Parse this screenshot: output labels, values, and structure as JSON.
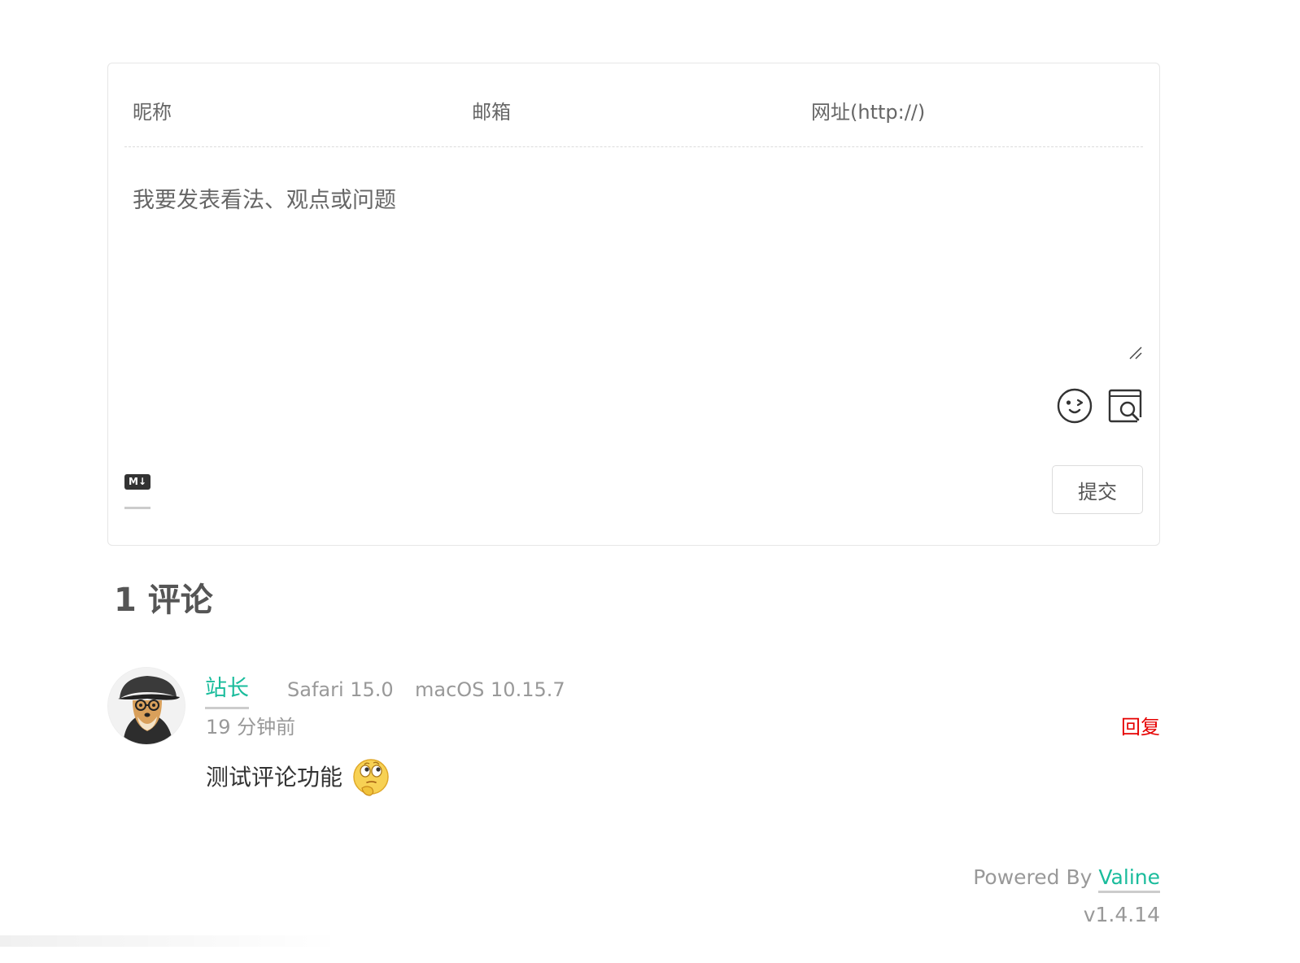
{
  "form": {
    "nick_placeholder": "昵称",
    "mail_placeholder": "邮箱",
    "link_placeholder": "网址(http://)",
    "editor_placeholder": "我要发表看法、观点或问题",
    "markdown_badge": "M↓",
    "submit_label": "提交",
    "tools": [
      "emoji-icon",
      "preview-icon"
    ]
  },
  "comments_header": {
    "count_text": "1 评论"
  },
  "comments": [
    {
      "nick": "站长",
      "browser": "Safari 15.0",
      "os": "macOS 10.15.7",
      "time": "19 分钟前",
      "reply_label": "回复",
      "content": "测试评论功能",
      "avatar": "dog-with-cap-avatar",
      "content_emoji": "thinking-emoji"
    }
  ],
  "footer": {
    "powered_prefix": "Powered By ",
    "powered_brand": "Valine",
    "version": "v1.4.14"
  },
  "colors": {
    "accent": "#1abc9c",
    "reply": "#e60000",
    "muted": "#999999"
  }
}
